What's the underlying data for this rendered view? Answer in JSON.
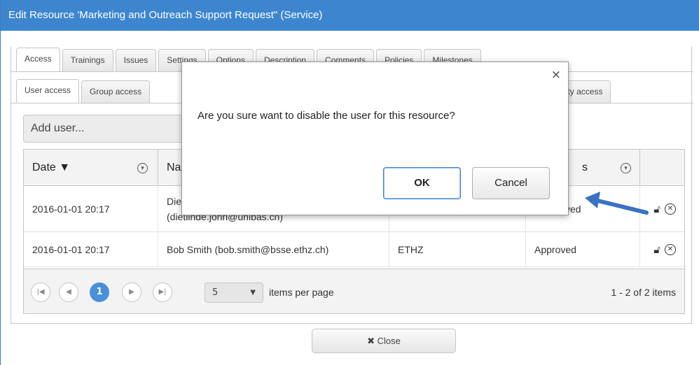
{
  "window": {
    "title": "Edit Resource 'Marketing and Outreach Support Request\" (Service)"
  },
  "tabs_primary": [
    "Access",
    "Trainings",
    "Issues",
    "Settings",
    "Options",
    "Description",
    "Comments",
    "Policies",
    "Milestones"
  ],
  "tabs_secondary": [
    "User access",
    "Group access",
    "Community access"
  ],
  "add_user": {
    "placeholder": "Add user..."
  },
  "table": {
    "headers": {
      "date": "Date ▼",
      "name": "Na",
      "status": "s"
    },
    "rows": [
      {
        "date": "2016-01-01 20:17",
        "name_line1": "Die",
        "name_line2": "(dietlinde.john@unibas.ch)",
        "org": "",
        "status": "ved"
      },
      {
        "date": "2016-01-01 20:17",
        "name_line1": "Bob Smith (bob.smith@bsse.ethz.ch)",
        "name_line2": "",
        "org": "ETHZ",
        "status": "Approved"
      }
    ]
  },
  "pager": {
    "current_page": "1",
    "page_size": "5",
    "per_page_label": "items per page",
    "info": "1 - 2 of 2 items"
  },
  "close_button": {
    "label": "✖ Close"
  },
  "dialog": {
    "message": "Are you sure want to disable the user for this resource?",
    "ok_label": "OK",
    "cancel_label": "Cancel",
    "close_glyph": "×"
  },
  "icons": {
    "unlock": "unlock-icon",
    "remove": "remove-circle-icon",
    "filter": "filter-icon"
  },
  "colors": {
    "titlebar": "#3d86cf",
    "accent": "#4a90d9",
    "arrow": "#3a72c4"
  }
}
